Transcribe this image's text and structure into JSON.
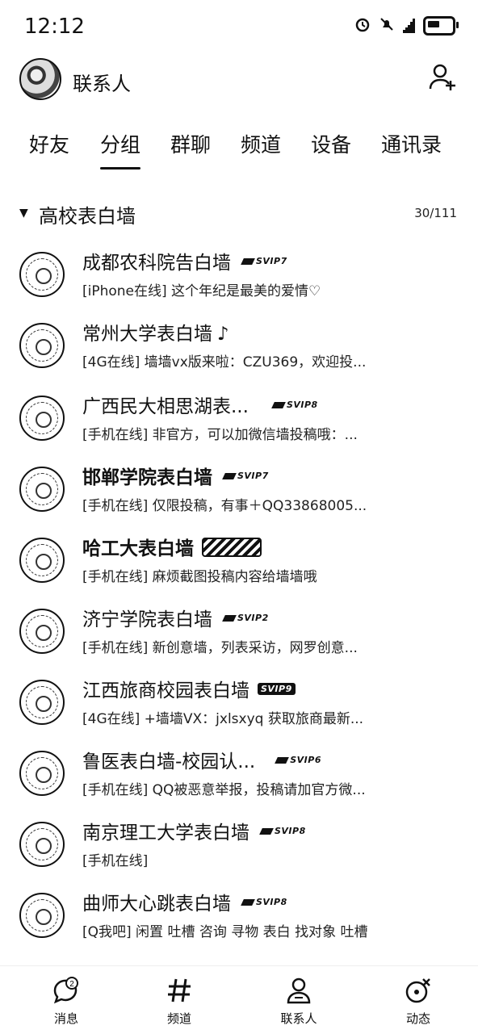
{
  "status_bar": {
    "time": "12:12"
  },
  "header": {
    "title": "联系人"
  },
  "tabs": [
    {
      "label": "好友"
    },
    {
      "label": "分组"
    },
    {
      "label": "群聊"
    },
    {
      "label": "频道"
    },
    {
      "label": "设备"
    },
    {
      "label": "通讯录"
    }
  ],
  "group": {
    "name": "高校表白墙",
    "count": "30/111"
  },
  "contacts": [
    {
      "name": "成都农科院告白墙",
      "status": "[iPhone在线] 这个年纪是最美的爱情♡",
      "badge": "SVIP7"
    },
    {
      "name": "常州大学表白墙",
      "status": "[4G在线] 墙墙vx版来啦：CZU369，欢迎投...",
      "badge": ""
    },
    {
      "name": "广西民大相思湖表...",
      "status": "[手机在线] 非官方，可以加微信墙投稿哦：...",
      "badge": "SVIP8"
    },
    {
      "name": "邯郸学院表白墙",
      "status": "[手机在线] 仅限投稿，有事＋QQ33868005...",
      "badge": "SVIP7"
    },
    {
      "name": "哈工大表白墙",
      "status": "[手机在线] 麻烦截图投稿内容给墙墙哦",
      "badge": ""
    },
    {
      "name": "济宁学院表白墙",
      "status": "[手机在线] 新创意墙，列表采访，网罗创意...",
      "badge": "SVIP2"
    },
    {
      "name": "江西旅商校园表白墙",
      "status": "[4G在线] +墙墙VX：jxlsxyq   获取旅商最新...",
      "badge": "SVIP9"
    },
    {
      "name": "鲁医表白墙-校园认...",
      "status": "[手机在线] QQ被恶意举报，投稿请加官方微...",
      "badge": "SVIP6"
    },
    {
      "name": "南京理工大学表白墙",
      "status": "[手机在线]",
      "badge": "SVIP8"
    },
    {
      "name": "曲师大心跳表白墙",
      "status": "[Q我吧] 闲置 吐槽 咨询 寻物 表白 找对象 吐槽",
      "badge": "SVIP8"
    }
  ],
  "bottom_nav": [
    {
      "label": "消息",
      "icon": "chat-bubble-icon"
    },
    {
      "label": "频道",
      "icon": "hash-icon"
    },
    {
      "label": "联系人",
      "icon": "person-icon"
    },
    {
      "label": "动态",
      "icon": "star-orbit-icon"
    }
  ]
}
